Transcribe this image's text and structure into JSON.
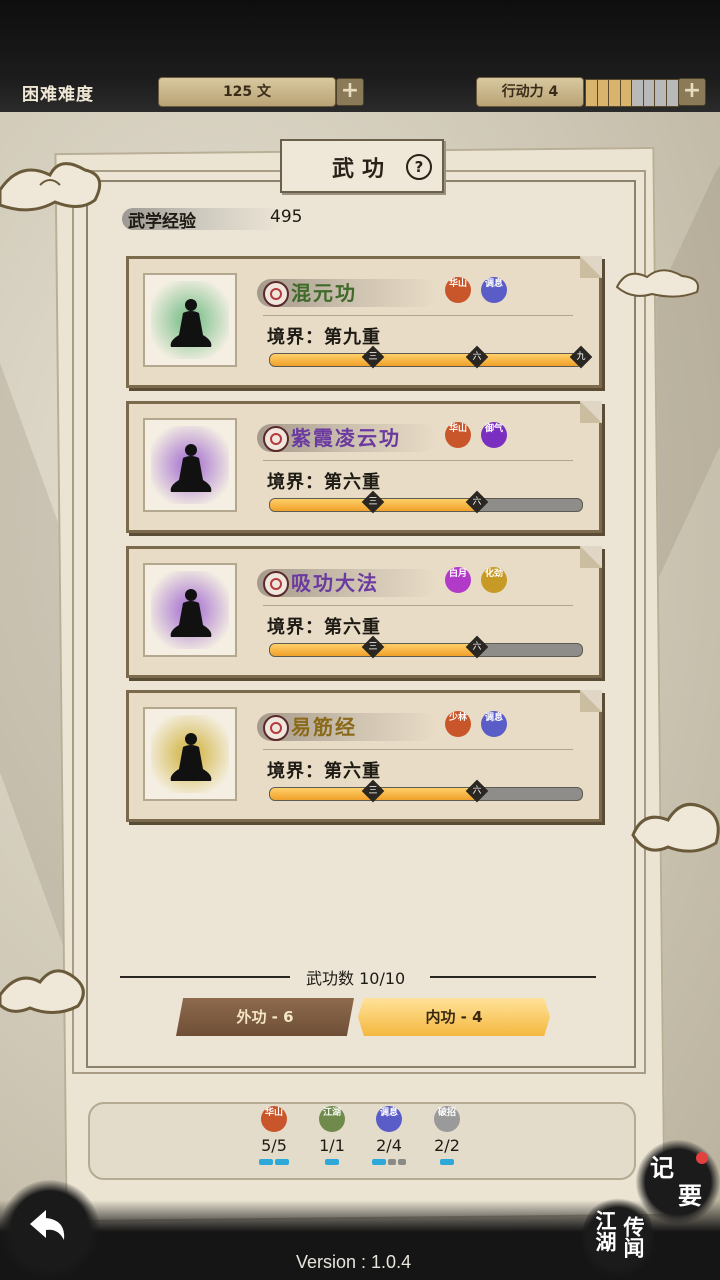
{
  "topbar": {
    "difficulty": "困难难度",
    "money": "125 文",
    "action_power": "行动力 4",
    "action_segments": {
      "filled": 4,
      "total": 8
    }
  },
  "title": {
    "text": "武功",
    "help": "?"
  },
  "experience": {
    "label": "武学经验",
    "value": "495"
  },
  "skills": [
    {
      "name": "混元功",
      "name_color": "#3e6b2a",
      "portrait_color": "#8fc79a",
      "badges": [
        {
          "text": "华山",
          "color": "#c9552b"
        },
        {
          "text": "调息",
          "color": "#5a5cc8"
        }
      ],
      "realm": "境界：第九重",
      "progress": 1.0,
      "ticks": [
        "三",
        "六",
        "九"
      ]
    },
    {
      "name": "紫霞凌云功",
      "name_color": "#6b3aa0",
      "portrait_color": "#b58ad4",
      "badges": [
        {
          "text": "华山",
          "color": "#c9552b"
        },
        {
          "text": "御气",
          "color": "#7a2fc0"
        }
      ],
      "realm": "境界：第六重",
      "progress": 0.667,
      "ticks": [
        "三",
        "六"
      ]
    },
    {
      "name": "吸功大法",
      "name_color": "#6b3aa0",
      "portrait_color": "#b58ad4",
      "badges": [
        {
          "text": "白月",
          "color": "#b23ac8"
        },
        {
          "text": "化劲",
          "color": "#c79a25"
        }
      ],
      "realm": "境界：第六重",
      "progress": 0.667,
      "ticks": [
        "三",
        "六"
      ]
    },
    {
      "name": "易筋经",
      "name_color": "#8a6a18",
      "portrait_color": "#d8bf62",
      "badges": [
        {
          "text": "少林",
          "color": "#c9552b"
        },
        {
          "text": "调息",
          "color": "#5a5cc8"
        }
      ],
      "realm": "境界：第六重",
      "progress": 0.667,
      "ticks": [
        "三",
        "六"
      ]
    }
  ],
  "skill_count": "武功数 10/10",
  "tabs": {
    "outer": "外功 - 6",
    "inner": "内功 - 4"
  },
  "stats": [
    {
      "badge": "华山",
      "color": "#c9552b",
      "value": "5/5",
      "pips_on": 2,
      "pips_off": 0
    },
    {
      "badge": "江湖",
      "color": "#6f8a4a",
      "value": "1/1",
      "pips_on": 1,
      "pips_off": 0
    },
    {
      "badge": "调息",
      "color": "#5a5cc8",
      "value": "2/4",
      "pips_on": 1,
      "pips_off": 2
    },
    {
      "badge": "破招",
      "color": "#9a9a9a",
      "value": "2/2",
      "pips_on": 1,
      "pips_off": 0
    }
  ],
  "bottom": {
    "version": "Version : 1.0.4",
    "jiyao_1": "记",
    "jiyao_2": "要",
    "jianghu_1": "江湖",
    "jianghu_2": "传闻"
  }
}
